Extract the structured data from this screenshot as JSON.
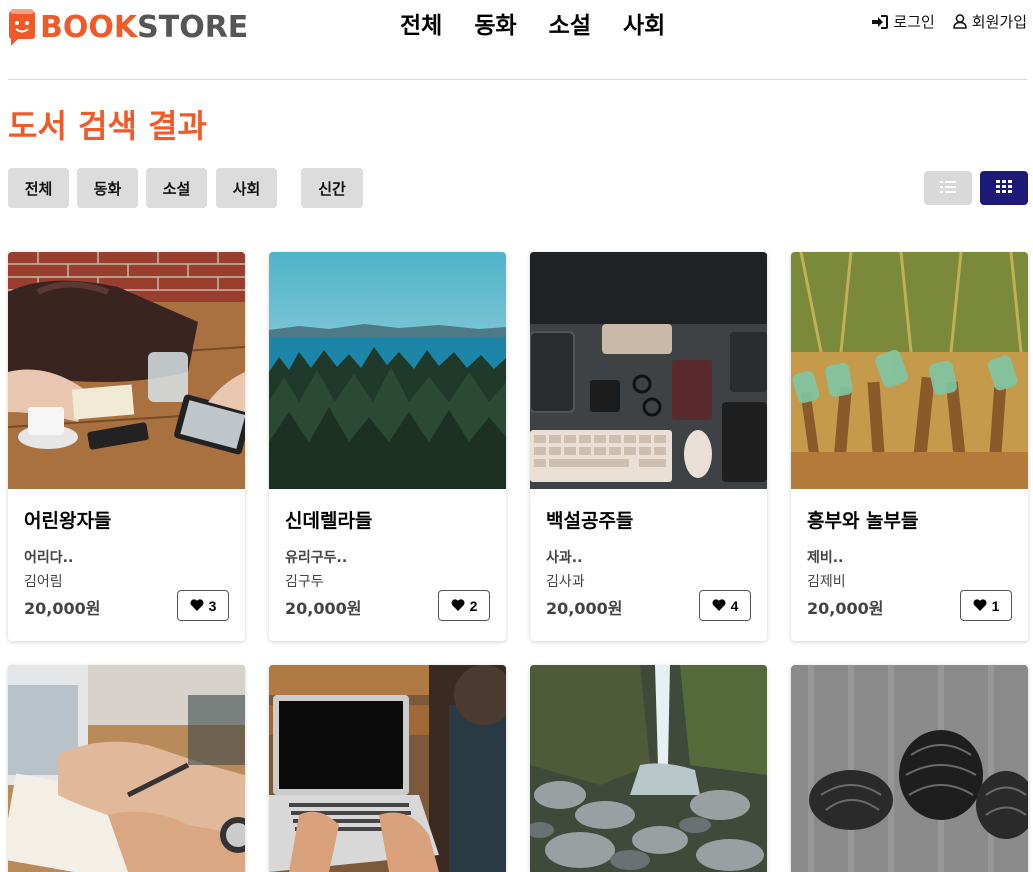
{
  "brand": {
    "part1": "BOOK",
    "part2": "STORE",
    "accent": "#f05a28"
  },
  "nav": {
    "items": [
      "전체",
      "동화",
      "소설",
      "사회"
    ]
  },
  "user_menu": {
    "login": "로그인",
    "signup": "회원가입"
  },
  "page_title": "도서 검색 결과",
  "filters": [
    "전체",
    "동화",
    "소설",
    "사회",
    "신간"
  ],
  "view_modes": {
    "active": "grid",
    "active_color": "#1e1a78"
  },
  "books": [
    {
      "title": "어린왕자들",
      "summary": "어리다..",
      "author": "김어림",
      "price": "20,000원",
      "likes": "3"
    },
    {
      "title": "신데렐라들",
      "summary": "유리구두..",
      "author": "김구두",
      "price": "20,000원",
      "likes": "2"
    },
    {
      "title": "백설공주들",
      "summary": "사과..",
      "author": "김사과",
      "price": "20,000원",
      "likes": "4"
    },
    {
      "title": "흥부와 놀부들",
      "summary": "제비..",
      "author": "김제비",
      "price": "20,000원",
      "likes": "1"
    }
  ]
}
